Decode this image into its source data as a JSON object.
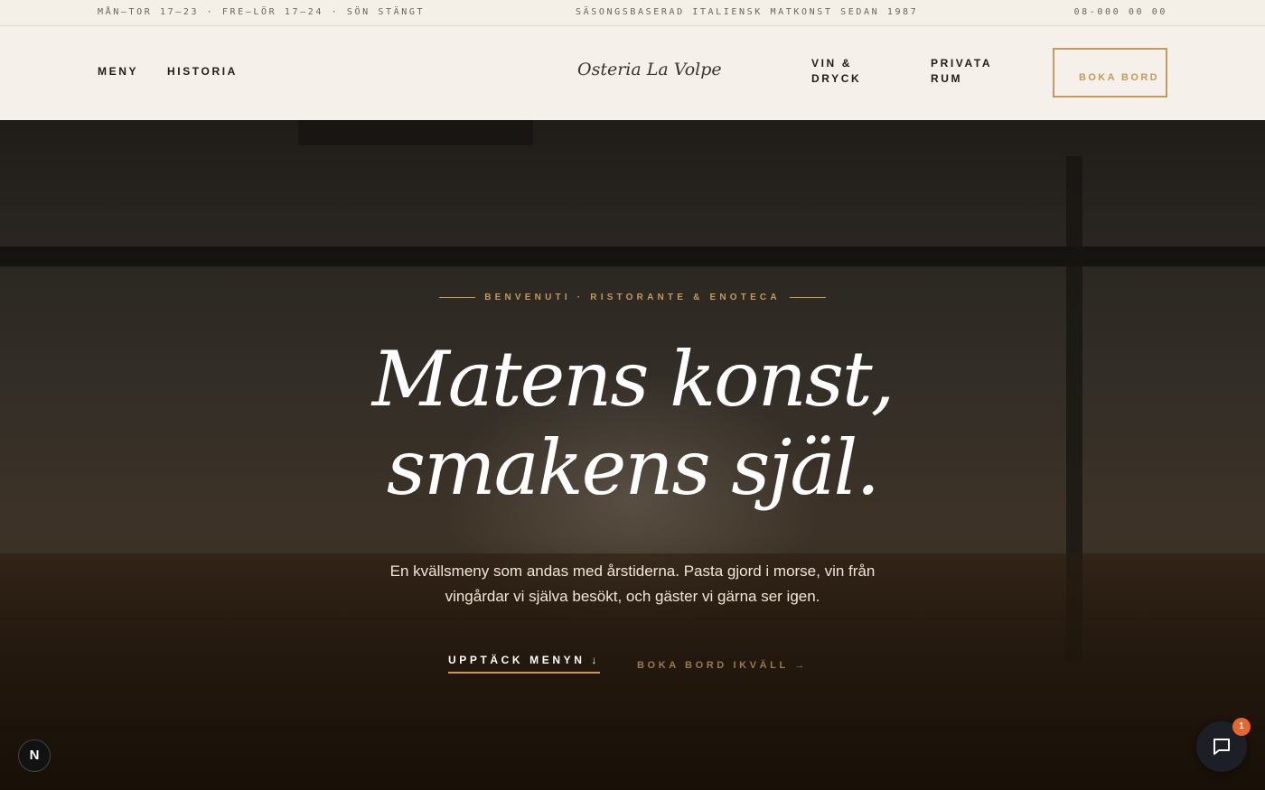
{
  "topbar": {
    "hours": "MÅN–TOR 17–23 · FRE–LÖR 17–24 · SÖN STÄNGT",
    "tagline": "SÄSONGSBASERAD ITALIENSK MATKONST SEDAN 1987",
    "phone": "08-000 00 00"
  },
  "nav": {
    "menu": "MENY",
    "history": "HISTORIA",
    "logo": "Osteria La Volpe",
    "wine": "VIN & DRYCK",
    "private": "PRIVATA RUM",
    "book": "BOKA BORD"
  },
  "hero": {
    "eyebrow": "BENVENUTI · RISTORANTE & ENOTECA",
    "headline_line1": "Matens konst,",
    "headline_line2": "smakens själ.",
    "lead": "En kvällsmeny som andas med årstiderna. Pasta gjord i morse, vin från vingårdar vi själva besökt, och gäster vi gärna ser igen.",
    "cta_primary": "UPPTÄCK MENYN ↓",
    "cta_secondary": "BOKA BORD IKVÄLL →"
  },
  "widgets": {
    "n_badge": "N",
    "chat_count": "1"
  },
  "colors": {
    "accent": "#c49a5c",
    "background": "#f5f1ea",
    "ink": "#1f1b16"
  }
}
